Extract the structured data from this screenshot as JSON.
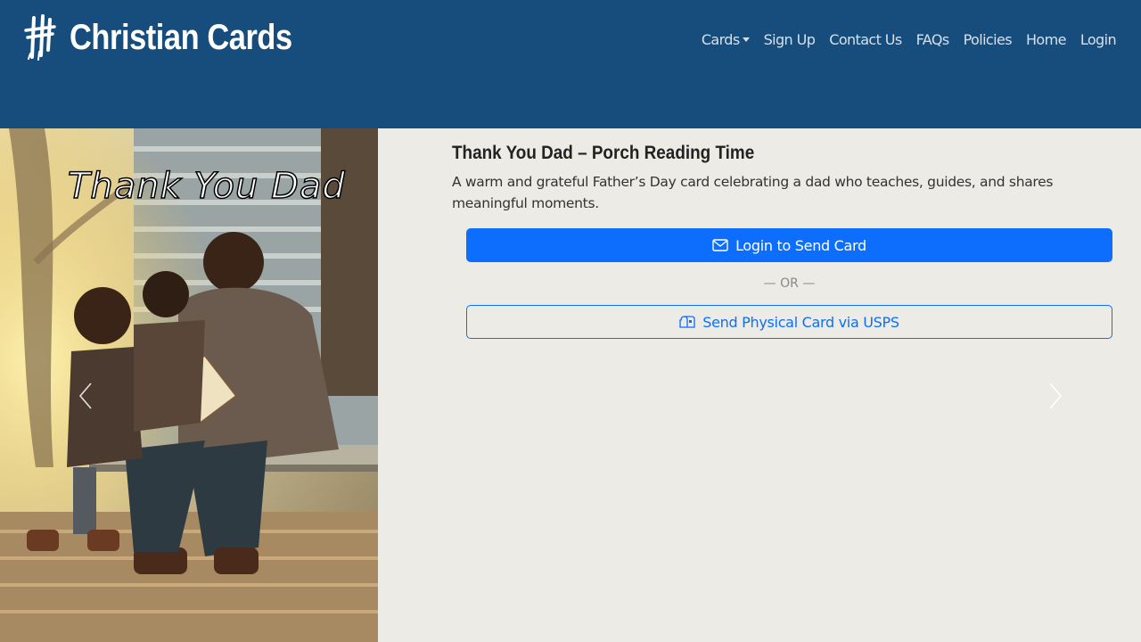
{
  "brand": {
    "name": "Christian Cards",
    "logo_icon": "cross-logo-icon"
  },
  "nav": {
    "items": [
      {
        "label": "Cards",
        "has_dropdown": true
      },
      {
        "label": "Sign Up"
      },
      {
        "label": "Contact Us"
      },
      {
        "label": "FAQs"
      },
      {
        "label": "Policies"
      },
      {
        "label": "Home"
      },
      {
        "label": "Login"
      }
    ]
  },
  "card": {
    "image_text": "Thank You Dad",
    "title": "Thank You Dad – Porch Reading Time",
    "description": "A warm and grateful Father’s Day card celebrating a dad who teaches, guides, and shares meaningful moments."
  },
  "actions": {
    "login_send_label": "Login to Send Card",
    "or_label": "— OR —",
    "physical_label": "Send Physical Card via USPS"
  },
  "colors": {
    "navbar": "#174d7c",
    "background": "#ecebe6",
    "primary": "#0d6efd"
  }
}
